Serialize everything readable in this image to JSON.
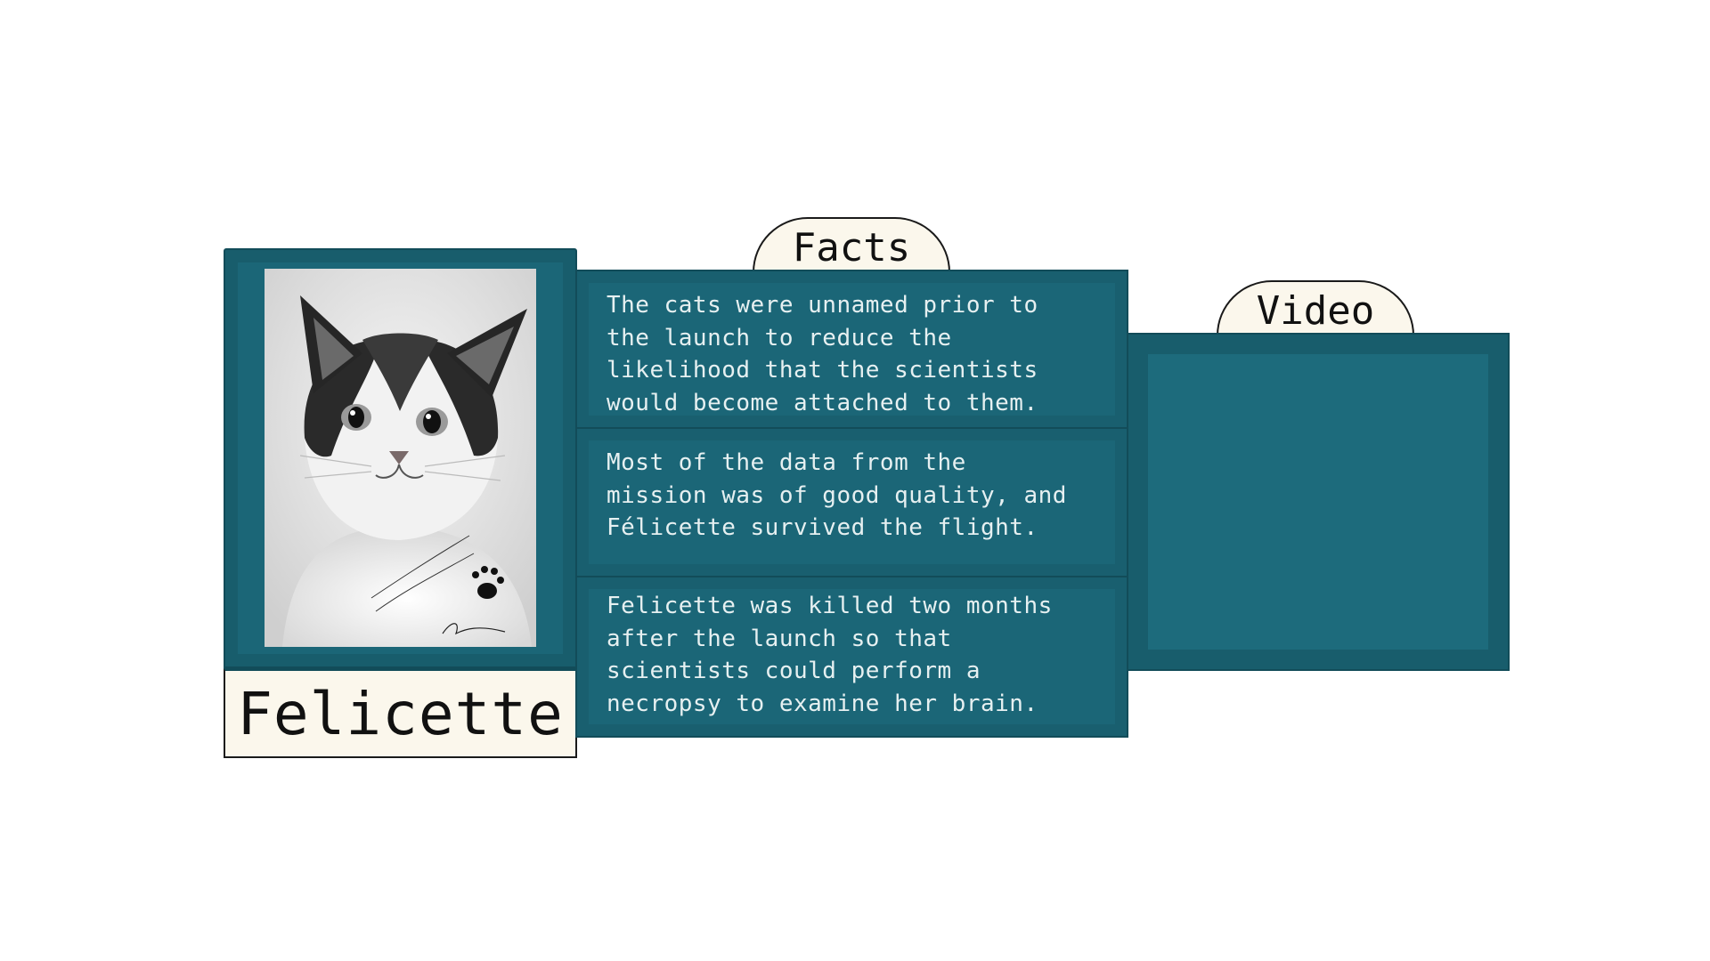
{
  "card": {
    "name": "Felicette",
    "photo_alt": "cat-portrait-photo"
  },
  "facts": {
    "tab_label": "Facts",
    "items": [
      "The cats were unnamed prior to\nthe launch to reduce the\nlikelihood that the scientists\nwould become attached to them.",
      "Most of the data from the\nmission was of good quality, and\nFélicette survived the flight.",
      "Felicette was killed two months\nafter the launch so that\nscientists could perform a\nnecropsy to examine her brain."
    ]
  },
  "video": {
    "tab_label": "Video"
  },
  "colors": {
    "panel": "#1b6677",
    "panel_border": "#124c59",
    "tab": "#fbf7ec",
    "text_light": "#e6f0f1"
  }
}
